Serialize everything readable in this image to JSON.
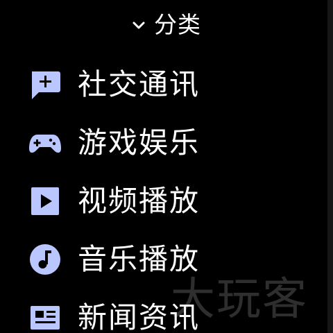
{
  "header": {
    "title": "分类",
    "toggle_icon": "chevron-down-icon"
  },
  "colors": {
    "background": "#000000",
    "text": "#ffffff",
    "icon_accent": "#b9c6ff"
  },
  "menu": {
    "items": [
      {
        "label": "社交通讯",
        "icon": "chat-add-icon"
      },
      {
        "label": "游戏娱乐",
        "icon": "gamepad-icon"
      },
      {
        "label": "视频播放",
        "icon": "video-play-icon"
      },
      {
        "label": "音乐播放",
        "icon": "music-note-icon"
      },
      {
        "label": "新闻资讯",
        "icon": "news-article-icon"
      }
    ]
  },
  "watermark": {
    "text": "大玩客"
  }
}
